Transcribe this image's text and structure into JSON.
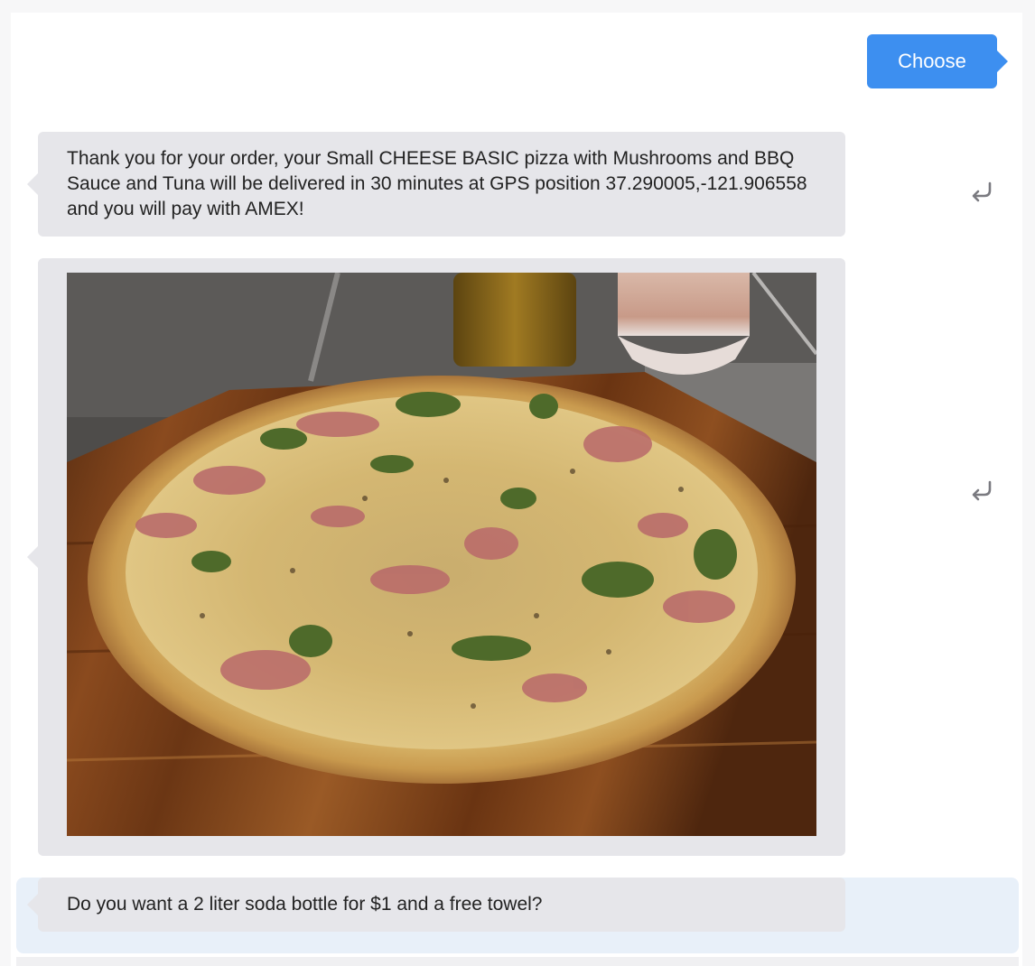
{
  "user_message": {
    "label": "Choose"
  },
  "bot_messages": [
    {
      "text": "Thank you for your order, your Small CHEESE BASIC pizza with Mushrooms and BBQ Sauce and Tuna will be delivered in 30 minutes at GPS position 37.290005,-121.906558 and you will pay with AMEX!"
    },
    {
      "image": "pizza-photo"
    },
    {
      "text": "Do you want a 2 liter soda bottle for $1 and a free towel?"
    }
  ],
  "icons": {
    "reply": "reply-arrow-icon"
  },
  "colors": {
    "user_bubble": "#3d8ff0",
    "bot_bubble": "#e6e6ea",
    "highlight_row": "#e8f0f9"
  }
}
